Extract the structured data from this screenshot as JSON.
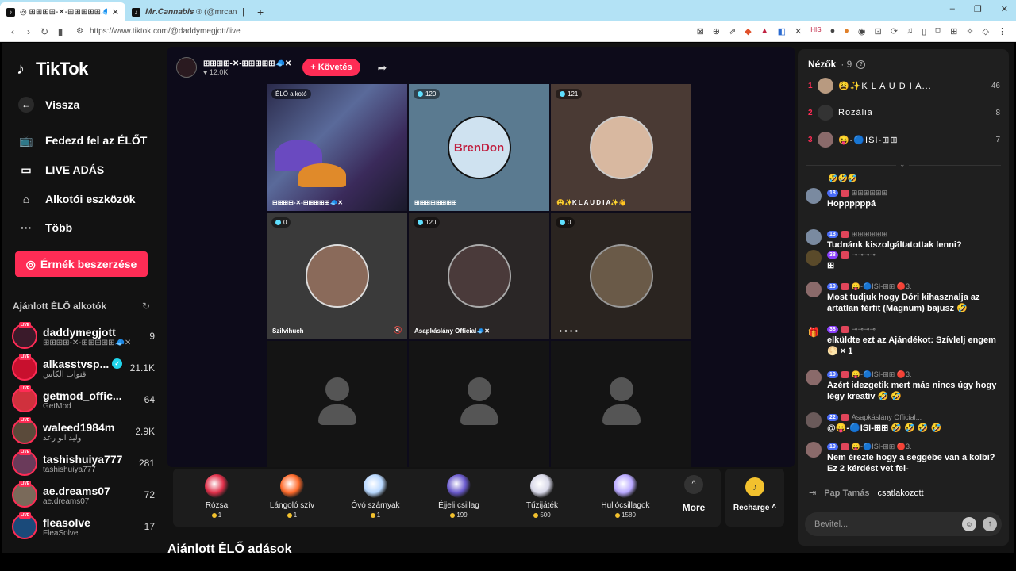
{
  "browser": {
    "tabs": [
      {
        "label": "◎ ⊞⊞⊞⊞-✕-⊞⊞⊞⊞⊞🧢✕ (@da",
        "active": true
      },
      {
        "label": "𝑴𝒓.𝑪𝒂𝒏𝒏𝒂𝒃𝒊𝒔 ® (@mrcannabis",
        "active": false
      }
    ],
    "new_tab": "+",
    "url": "https://www.tiktok.com/@daddymegjott/live"
  },
  "sidebar": {
    "logo": "TikTok",
    "back": "Vissza",
    "nav": [
      {
        "label": "Fedezd fel az ÉLŐT",
        "icon": "tv-icon"
      },
      {
        "label": "LIVE ADÁS",
        "icon": "camera-icon"
      },
      {
        "label": "Alkotói eszközök",
        "icon": "creator-tools-icon"
      },
      {
        "label": "Több",
        "icon": "more-icon"
      }
    ],
    "coins_button": "Érmék beszerzése",
    "recommended_title": "Ajánlott ÉLŐ alkotók",
    "creators": [
      {
        "name": "daddymegjott",
        "sub": "⊞⊞⊞⊞-✕-⊞⊞⊞⊞⊞🧢✕",
        "count": "9",
        "color": "#3a1a2a"
      },
      {
        "name": "alkasstvsp...",
        "sub": "قنوات الكأس",
        "count": "21.1K",
        "verified": true,
        "color": "#c8102e"
      },
      {
        "name": "getmod_offic...",
        "sub": "GetMod",
        "count": "64",
        "color": "#d0313d"
      },
      {
        "name": "waleed1984m",
        "sub": "وليد ابو رعد",
        "count": "2.9K",
        "color": "#5a4a3a"
      },
      {
        "name": "tashishuiya777",
        "sub": "tashishuiya777",
        "count": "281",
        "color": "#6a3a5a"
      },
      {
        "name": "ae.dreams07",
        "sub": "ae.dreams07",
        "count": "72",
        "color": "#7a6a5a"
      },
      {
        "name": "fleasolve",
        "sub": "FleaSolve",
        "count": "17",
        "color": "#1a4a7a"
      }
    ]
  },
  "stream": {
    "host_name": "⊞⊞⊞⊞-✕-⊞⊞⊞⊞⊞🧢✕",
    "host_likes": "♥ 12.0K",
    "follow_label": "+ Követés",
    "cells": [
      {
        "badge": "ÉLŐ alkotó",
        "name": "⊞⊞⊞⊞-✕-⊞⊞⊞⊞⊞🧢✕"
      },
      {
        "badge": "120",
        "name": "⊞⊞⊞⊞⊞⊞⊞⊞",
        "avatar_text": "BrenDon"
      },
      {
        "badge": "121",
        "name": "😩✨K L A U D I A✨👋"
      },
      {
        "badge": "0",
        "name": "Szilvihuch"
      },
      {
        "badge": "120",
        "name": "Asapkáslány Official🧢✕"
      },
      {
        "badge": "0",
        "name": "⊸⊸⊸⊸"
      }
    ],
    "gifts": [
      {
        "name": "Rózsa",
        "price": "1",
        "color": "#e0304a"
      },
      {
        "name": "Lángoló szív",
        "price": "1",
        "color": "#ff6a2a"
      },
      {
        "name": "Óvó szárnyak",
        "price": "1",
        "color": "#b8d8ff"
      },
      {
        "name": "Éjjeli csillag",
        "price": "199",
        "color": "#6a5acd"
      },
      {
        "name": "Tűzijáték",
        "price": "500",
        "color": "#d8d8e8"
      },
      {
        "name": "Hullócsillagok",
        "price": "1580",
        "color": "#b8a8ff"
      }
    ],
    "more_label": "More",
    "recharge_label": "Recharge ^",
    "recommended_live": "Ajánlott ÉLŐ adások"
  },
  "chat": {
    "viewers_label": "Nézők",
    "viewers_count": "· 9",
    "top_viewers": [
      {
        "rank": "1",
        "name": "😩✨K L A U D I A...",
        "count": "46",
        "color": "#b89a80"
      },
      {
        "rank": "2",
        "name": "Rozália",
        "count": "8",
        "color": "#333"
      },
      {
        "rank": "3",
        "name": "😛-🔵ISI-⊞⊞",
        "count": "7",
        "color": "#8a6a6a"
      }
    ],
    "emoji_row": "🤣🤣🤣",
    "messages": [
      {
        "level": "18",
        "user": "⊞⊞⊞⊞⊞⊞",
        "text": "Hoppppppá",
        "color": "#7a8aa0"
      },
      {
        "level": "18",
        "user": "⊞⊞⊞⊞⊞⊞",
        "text": "Tudnánk kiszolgáltatottak lenni?",
        "color": "#7a8aa0"
      },
      {
        "level": "38",
        "user": "⊸⊸⊸⊸",
        "text": "⊞",
        "color": "#5a4a2a"
      },
      {
        "level": "19",
        "user": "😛-🔵ISI-⊞⊞ 🔴3.",
        "text": "Most tudjuk hogy Dóri kihasznalja az ártatlan férfit (Magnum) bajusz 🤣",
        "color": "#8a6a6a"
      },
      {
        "level": "38",
        "user": "⊸⊸⊸⊸",
        "text": "elküldte ezt az Ajándékot: Szívlelj engem 🌕 × 1",
        "color": "#1f1f1f"
      },
      {
        "level": "19",
        "user": "😛-🔵ISI-⊞⊞ 🔴3.",
        "text": "Azért idezgetik mert más nincs úgy hogy légy kreatív 🤣 🤣",
        "color": "#8a6a6a"
      },
      {
        "level": "22",
        "user": "Asapkáslány Official...",
        "text": "@😛-🔵ISI-⊞⊞ 🤣 🤣 🤣 🤣",
        "color": "#6a5a5a"
      },
      {
        "level": "19",
        "user": "😛-🔵ISI-⊞⊞ 🔴3.",
        "text": "Nem érezte hogy a seggébe van a kolbi? Ez 2 kérdést vet fel-",
        "color": "#8a6a6a"
      }
    ],
    "join_user": "Pap Tamás",
    "join_text": "csatlakozott",
    "input_placeholder": "Bevitel..."
  }
}
